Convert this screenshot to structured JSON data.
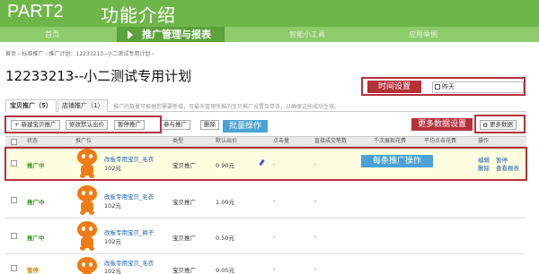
{
  "banner": {
    "part": "PART2",
    "title": "功能介绍"
  },
  "nav": {
    "home": "首页",
    "active": "推广管理与报表",
    "tools": "智能小工具",
    "cases": "应用举例"
  },
  "breadcrumb": "首页  ›  标准推广  ›  推广计划：12233213--小二测试专用计划 ›",
  "plan_title": "12233213--小二测试专用计划",
  "annotations": {
    "time_setting": "时间设置",
    "more_data": "更多数据设置",
    "batch": "批量操作",
    "single": "每条推广操作"
  },
  "date_value": "昨天",
  "tabs": {
    "baobei": "宝贝推广（5）",
    "dianpu": "店铺推广（1）"
  },
  "hint": "推广的数量可根据您需要新增，可最多管理所推的宝贝推广设置及单条，以确保这些成功生效。",
  "toolbar": {
    "new": "+ 新建宝贝推广",
    "modify_bid": "修改默认出价",
    "pause": "暂停推广",
    "join": "参与推广",
    "delete": "删除",
    "more": "更多数据"
  },
  "columns": {
    "status": "状态",
    "promo": "推广位",
    "type": "类型",
    "bid": "默认出价",
    "clicks": "点击量",
    "direct": "直接成交笔数",
    "cost": "千次展现花费",
    "avg": "平均点击花费",
    "ops": "操作"
  },
  "rows": [
    {
      "status": "推广中",
      "name": "改板专用宝贝_毛衣",
      "price": "102元",
      "type": "宝贝推广",
      "bid": "0.90元",
      "clicks": "-",
      "direct": "-",
      "op1": "编辑",
      "op2": "暂停",
      "op3": "删除",
      "op4": "查看报表"
    },
    {
      "status": "推广中",
      "name": "改板专用宝贝_毛衣",
      "price": "102元",
      "type": "宝贝推广",
      "bid": "1.00元",
      "clicks": "-",
      "direct": "-"
    },
    {
      "status": "推广中",
      "name": "改板专用宝贝_裤子",
      "price": "102元",
      "type": "宝贝推广",
      "bid": "0.50元",
      "clicks": "-",
      "direct": "-"
    },
    {
      "status": "暂停",
      "name": "改板专用宝贝_毛衣",
      "price": "102元",
      "type": "宝贝推广",
      "bid": "0.05元",
      "clicks": "-",
      "direct": "-"
    }
  ],
  "colors": {
    "banner": "#6fb64a",
    "annotation_red": "#b5313a",
    "annotation_blue": "#4aa3d6",
    "mascot": "#f07c18"
  }
}
